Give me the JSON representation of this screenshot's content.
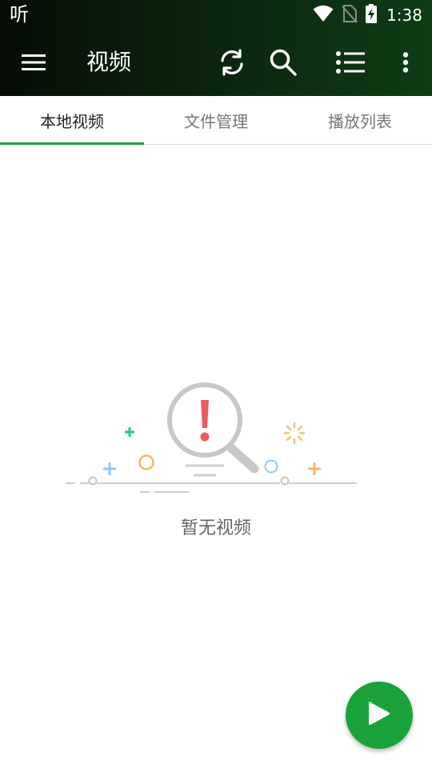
{
  "status_bar": {
    "app_glyph": "听",
    "time": "1:38",
    "icons": [
      "wifi-icon",
      "no-sim-icon",
      "battery-charging-icon"
    ]
  },
  "toolbar": {
    "title": "视频",
    "icons": [
      "menu-icon",
      "refresh-icon",
      "search-icon",
      "list-icon",
      "more-vert-icon"
    ]
  },
  "tabs": [
    {
      "label": "本地视频",
      "active": true
    },
    {
      "label": "文件管理",
      "active": false
    },
    {
      "label": "播放列表",
      "active": false
    }
  ],
  "empty_state": {
    "message": "暂无视频",
    "illustration": "magnifier-exclamation-icon"
  },
  "fab": {
    "icon": "play-icon"
  },
  "colors": {
    "header_dark": "#060d06",
    "header_green": "#0f3c15",
    "accent": "#1f9d3a",
    "fab": "#1aa33b",
    "exclamation": "#ec5b62"
  }
}
